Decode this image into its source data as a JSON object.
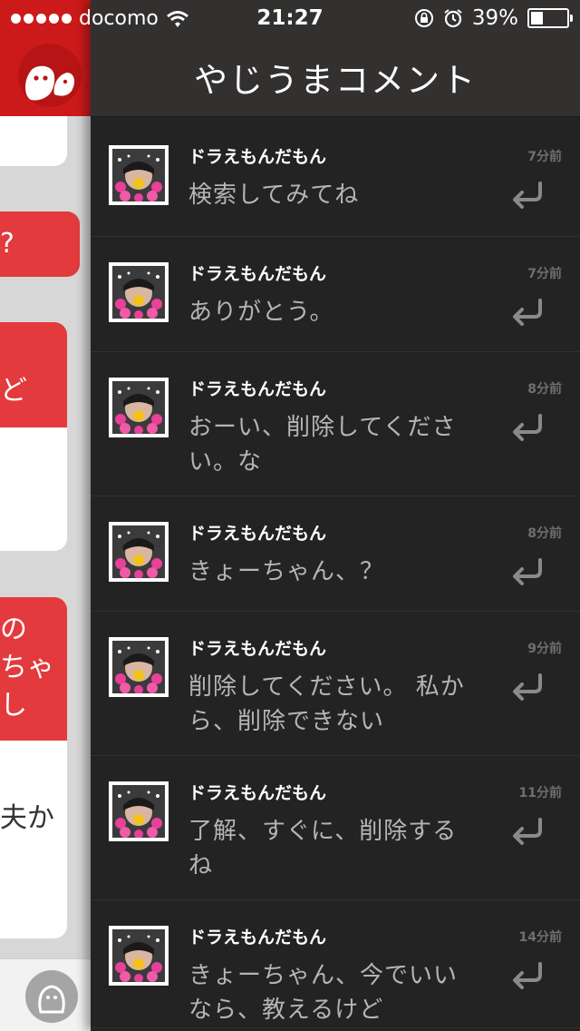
{
  "status_bar": {
    "carrier": "docomo",
    "time": "21:27",
    "battery_percent": "39%",
    "battery_level": 0.39,
    "icons": [
      "signal-dots-icon",
      "wifi-icon",
      "rotation-lock-icon",
      "alarm-icon",
      "battery-icon"
    ]
  },
  "header": {
    "title": "やじうまコメント"
  },
  "left_pane": {
    "bubbles": [
      "?",
      "ど",
      "の",
      "ちゃ",
      "し",
      "夫か"
    ],
    "colors": {
      "header": "#cc1a1a",
      "bubble_red": "#e33a3d",
      "bubble_white": "#ffffff"
    }
  },
  "comments": [
    {
      "user": "ドラえもんだもん",
      "time": "7分前",
      "text": "検索してみてね"
    },
    {
      "user": "ドラえもんだもん",
      "time": "7分前",
      "text": "ありがとう。"
    },
    {
      "user": "ドラえもんだもん",
      "time": "8分前",
      "text": "おーい、削除してくださ い。な"
    },
    {
      "user": "ドラえもんだもん",
      "time": "8分前",
      "text": "きょーちゃん、？"
    },
    {
      "user": "ドラえもんだもん",
      "time": "9分前",
      "text": "削除してください。 私か ら、削除できない"
    },
    {
      "user": "ドラえもんだもん",
      "time": "11分前",
      "text": "了解、すぐに、削除する ね"
    },
    {
      "user": "ドラえもんだもん",
      "time": "14分前",
      "text": "きょーちゃん、今でいい なら、教えるけど"
    }
  ],
  "colors": {
    "panel_bg": "#232323",
    "header_bg": "#333030",
    "accent_red": "#cc1a1a"
  }
}
